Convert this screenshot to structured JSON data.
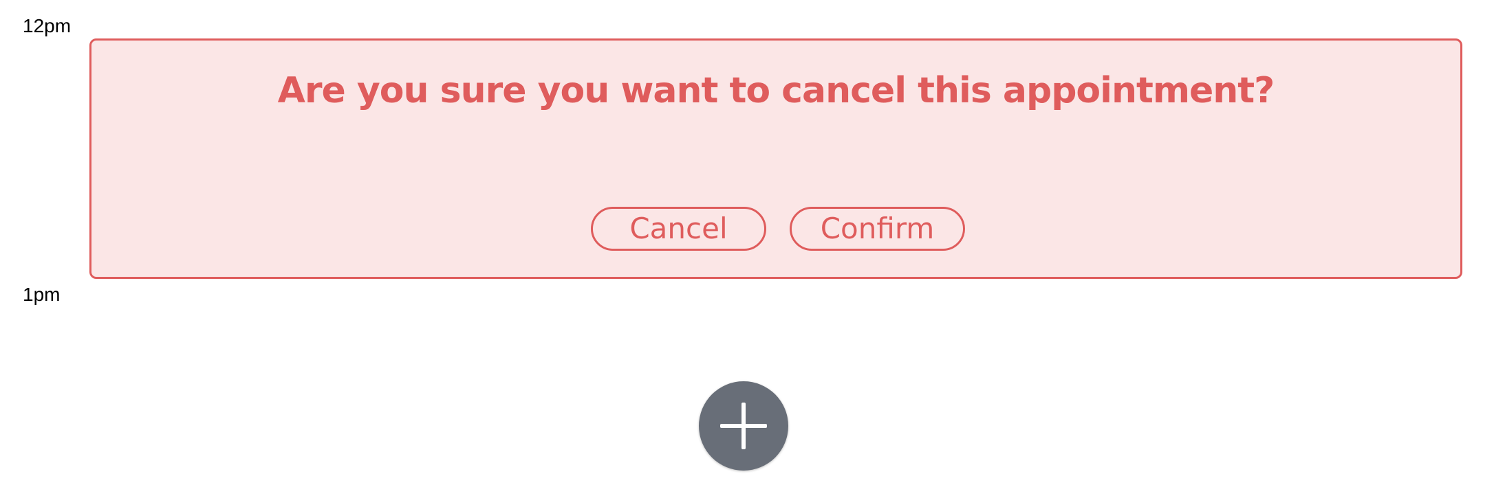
{
  "timeline": {
    "labels": [
      "12pm",
      "1pm"
    ]
  },
  "cancel_dialog": {
    "question": "Are you sure you want to cancel this appointment?",
    "cancel_label": "Cancel",
    "confirm_label": "Confirm",
    "accent_color": "#df5c5c",
    "background_color": "#fbe6e6"
  },
  "fab": {
    "icon": "plus-icon",
    "color": "#686e78"
  }
}
